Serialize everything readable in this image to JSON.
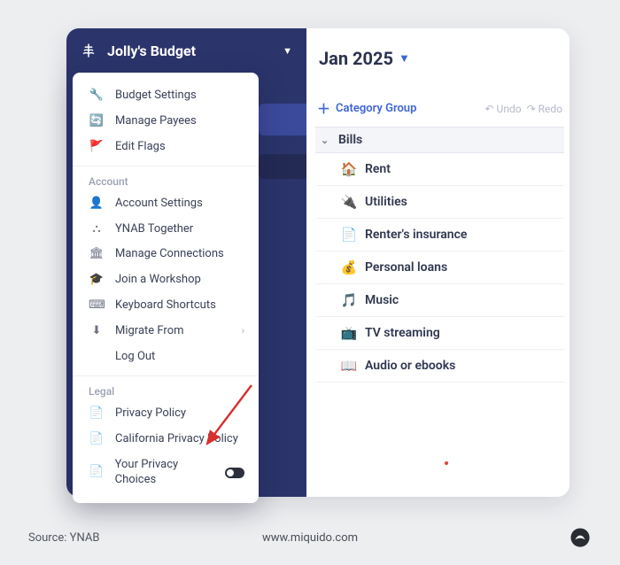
{
  "header": {
    "budget_name": "Jolly's Budget"
  },
  "menu": {
    "sections": {
      "top": [
        {
          "icon": "🔧",
          "label": "Budget Settings"
        },
        {
          "icon": "🔄",
          "label": "Manage Payees"
        },
        {
          "icon": "🚩",
          "label": "Edit Flags"
        }
      ],
      "account_header": "Account",
      "account": [
        {
          "icon": "👤",
          "label": "Account Settings"
        },
        {
          "icon": "⛬",
          "label": "YNAB Together"
        },
        {
          "icon": "🏛",
          "label": "Manage Connections"
        },
        {
          "icon": "🎓",
          "label": "Join a Workshop"
        },
        {
          "icon": "⌨",
          "label": "Keyboard Shortcuts"
        },
        {
          "icon": "⬇",
          "label": "Migrate From",
          "arrow": true
        },
        {
          "icon": "",
          "label": "Log Out"
        }
      ],
      "legal_header": "Legal",
      "legal": [
        {
          "icon": "📄",
          "label": "Privacy Policy"
        },
        {
          "icon": "📄",
          "label": "California Privacy Policy"
        },
        {
          "icon": "📄",
          "label": "Your Privacy Choices",
          "toggle": true
        }
      ]
    }
  },
  "main": {
    "month_label": "Jan 2025",
    "toolbar": {
      "category_group": "Category Group",
      "undo": "Undo",
      "redo": "Redo"
    },
    "group_name": "Bills",
    "categories": [
      {
        "icon": "🏠",
        "label": "Rent"
      },
      {
        "icon": "🔌",
        "label": "Utilities"
      },
      {
        "icon": "📄",
        "label": "Renter's insurance"
      },
      {
        "icon": "💰",
        "label": "Personal loans"
      },
      {
        "icon": "🎵",
        "label": "Music"
      },
      {
        "icon": "📺",
        "label": "TV streaming"
      },
      {
        "icon": "📖",
        "label": "Audio or ebooks"
      }
    ]
  },
  "footer": {
    "source": "Source: YNAB",
    "site": "www.miquido.com"
  }
}
